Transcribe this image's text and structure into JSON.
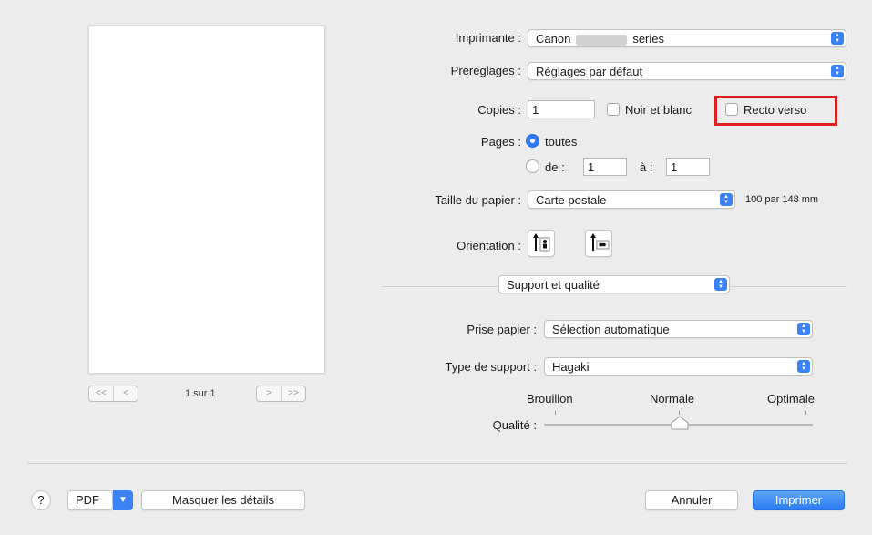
{
  "preview": {
    "page_indicator": "1 sur 1",
    "nav": {
      "first": "<<",
      "prev": "<",
      "next": ">",
      "last": ">>"
    }
  },
  "printer": {
    "label": "Imprimante :",
    "value_prefix": "Canon",
    "value_suffix": "series"
  },
  "presets": {
    "label": "Préréglages :",
    "value": "Réglages par défaut"
  },
  "copies": {
    "label": "Copies :",
    "value": "1",
    "bw_label": "Noir et blanc",
    "duplex_label": "Recto verso"
  },
  "pages": {
    "label": "Pages :",
    "all_label": "toutes",
    "from_label": "de :",
    "from_value": "1",
    "to_label": "à :",
    "to_value": "1"
  },
  "paper_size": {
    "label": "Taille du papier :",
    "value": "Carte postale",
    "dimensions": "100 par 148 mm"
  },
  "orientation": {
    "label": "Orientation :"
  },
  "panel_select": {
    "value": "Support et qualité"
  },
  "paper_source": {
    "label": "Prise papier :",
    "value": "Sélection automatique"
  },
  "media_type": {
    "label": "Type de support :",
    "value": "Hagaki"
  },
  "quality": {
    "label": "Qualité :",
    "options": [
      "Brouillon",
      "Normale",
      "Optimale"
    ],
    "selected": "Normale"
  },
  "footer": {
    "help_label": "?",
    "pdf_label": "PDF",
    "hide_details_label": "Masquer les détails",
    "cancel_label": "Annuler",
    "print_label": "Imprimer"
  },
  "colors": {
    "accent": "#2f7cf6",
    "highlight": "#e02020",
    "background": "#ececec"
  }
}
